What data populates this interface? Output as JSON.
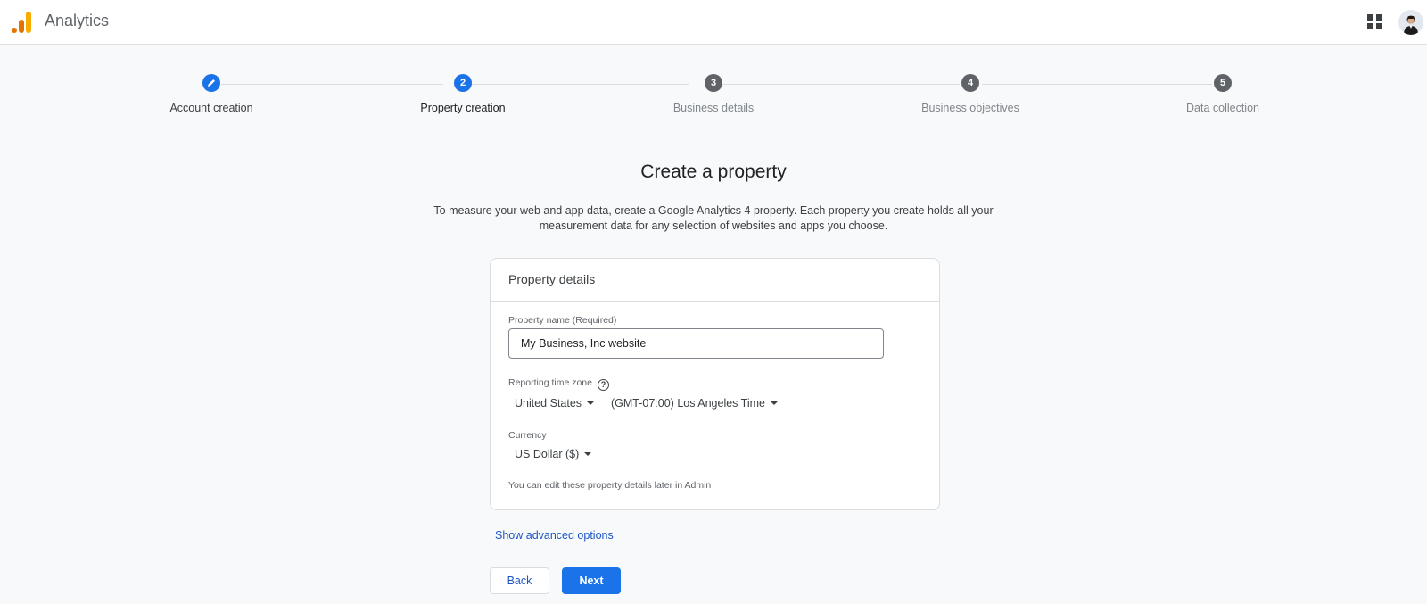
{
  "header": {
    "app_title": "Analytics",
    "apps_icon": "apps-grid-icon",
    "avatar_icon": "user-avatar"
  },
  "stepper": {
    "steps": [
      {
        "label": "Account creation",
        "marker": "edit-pencil-icon",
        "state": "completed"
      },
      {
        "label": "Property creation",
        "marker": "2",
        "state": "current"
      },
      {
        "label": "Business details",
        "marker": "3",
        "state": "upcoming"
      },
      {
        "label": "Business objectives",
        "marker": "4",
        "state": "upcoming"
      },
      {
        "label": "Data collection",
        "marker": "5",
        "state": "upcoming"
      }
    ]
  },
  "main": {
    "title": "Create a property",
    "description": "To measure your web and app data, create a Google Analytics 4 property. Each property you create holds all your measurement data for any selection of websites and apps you choose."
  },
  "card": {
    "header": "Property details",
    "property_name_label": "Property name (Required)",
    "property_name_value": "My Business, Inc website",
    "timezone_label": "Reporting time zone",
    "help_icon_glyph": "?",
    "country_value": "United States",
    "timezone_value": "(GMT-07:00) Los Angeles Time",
    "currency_label": "Currency",
    "currency_value": "US Dollar ($)",
    "note": "You can edit these property details later in Admin"
  },
  "actions": {
    "advanced_link": "Show advanced options",
    "back_label": "Back",
    "next_label": "Next"
  },
  "colors": {
    "primary": "#1a73e8",
    "logo_orange": "#f9ab00",
    "logo_dark_orange": "#e37400"
  }
}
